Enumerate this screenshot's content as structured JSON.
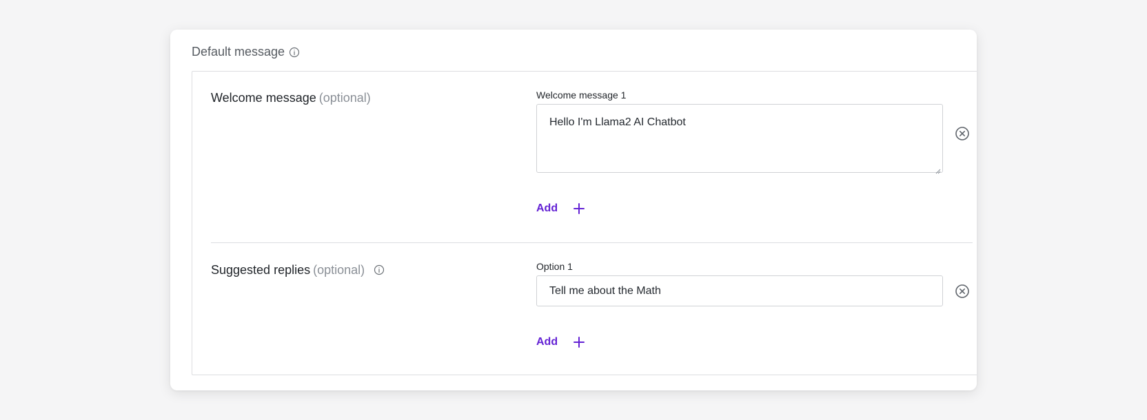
{
  "section": {
    "title": "Default message",
    "info_icon": "info-icon"
  },
  "welcome": {
    "label": "Welcome message",
    "optional": "(optional)",
    "field_label": "Welcome message 1",
    "value": "Hello I'm Llama2 AI Chatbot",
    "add_label": "Add"
  },
  "replies": {
    "label": "Suggested replies",
    "optional": "(optional)",
    "field_label": "Option 1",
    "value": "Tell me about the Math",
    "add_label": "Add"
  },
  "colors": {
    "accent": "#6321d4",
    "background": "#f5f5f6",
    "card": "#ffffff",
    "border": "#dcdde0"
  }
}
